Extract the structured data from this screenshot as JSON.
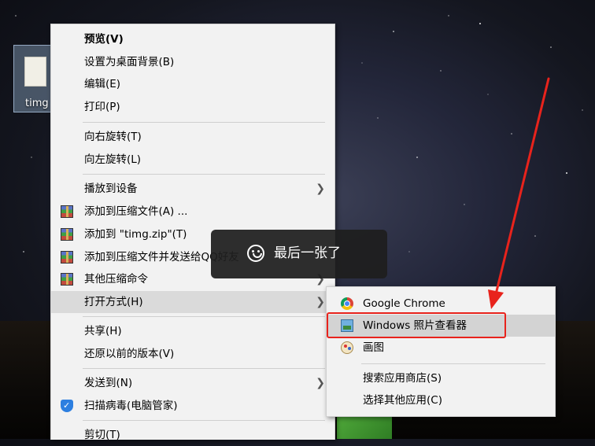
{
  "desktop": {
    "file_label": "timg"
  },
  "context_menu": {
    "items": [
      {
        "label": "预览(V)"
      },
      {
        "label": "设置为桌面背景(B)"
      },
      {
        "label": "编辑(E)"
      },
      {
        "label": "打印(P)"
      },
      {
        "label": "向右旋转(T)"
      },
      {
        "label": "向左旋转(L)"
      },
      {
        "label": "播放到设备"
      },
      {
        "label": "添加到压缩文件(A) ..."
      },
      {
        "label": "添加到 \"timg.zip\"(T)"
      },
      {
        "label": "添加到压缩文件并发送给QQ好友"
      },
      {
        "label": "其他压缩命令"
      },
      {
        "label": "打开方式(H)"
      },
      {
        "label": "共享(H)"
      },
      {
        "label": "还原以前的版本(V)"
      },
      {
        "label": "发送到(N)"
      },
      {
        "label": "扫描病毒(电脑管家)"
      },
      {
        "label": "剪切(T)"
      }
    ]
  },
  "open_with_menu": {
    "items": [
      {
        "label": "Google Chrome",
        "icon": "chrome-icon"
      },
      {
        "label": "Windows 照片查看器",
        "icon": "photo-viewer-icon"
      },
      {
        "label": "画图",
        "icon": "paint-icon"
      },
      {
        "label": "搜索应用商店(S)"
      },
      {
        "label": "选择其他应用(C)"
      }
    ]
  },
  "toast": {
    "message": "最后一张了"
  },
  "annotation": {
    "color": "#e8231c"
  }
}
